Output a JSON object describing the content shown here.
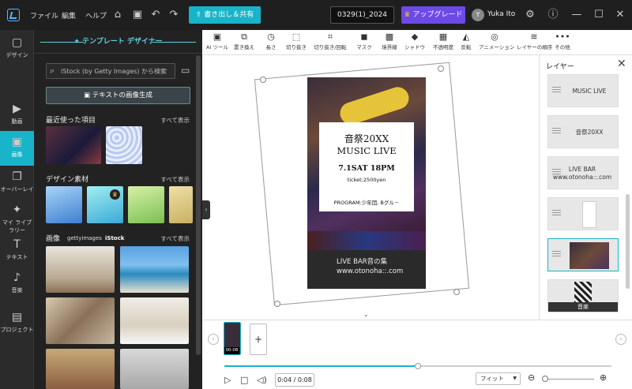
{
  "menu": [
    "ファイル",
    "編集",
    "ヘルプ"
  ],
  "toolbar_top": {
    "export_label": "書き出し＆共有",
    "filename": "0329(1)_2024",
    "upgrade_label": "アップグレード",
    "avatar_letter": "Y",
    "user_name": "Yuka Ito"
  },
  "rail": [
    {
      "icon": "▢",
      "label": "デザイン"
    },
    {
      "icon": "▶",
      "label": "動画"
    },
    {
      "icon": "▣",
      "label": "画像"
    },
    {
      "icon": "❐",
      "label": "オーバーレイ"
    },
    {
      "icon": "✦",
      "label": "マイ ライブラリー"
    },
    {
      "icon": "T",
      "label": "テキスト"
    },
    {
      "icon": "♪",
      "label": "音楽"
    },
    {
      "icon": "▤",
      "label": "プロジェクト"
    }
  ],
  "panel": {
    "title": "テンプレート デザイナー",
    "search_placeholder": "iStock (by Getty Images) から検索",
    "generate_label": "テキストの画像生成",
    "recent_heading": "最近使った項目",
    "design_heading": "デザイン素材",
    "images_heading": "画像",
    "see_all": "すべて表示",
    "getty": "gettyimages",
    "istock": "iStock"
  },
  "tools": [
    {
      "icon": "▣",
      "label": "AI ツール"
    },
    {
      "icon": "⧉",
      "label": "置き換え"
    },
    {
      "icon": "◷",
      "label": "長さ"
    },
    {
      "icon": "⬚",
      "label": "切り抜き"
    },
    {
      "icon": "⌗",
      "label": "切り抜き/回転"
    },
    {
      "icon": "◼",
      "label": "マスク"
    },
    {
      "icon": "▩",
      "label": "境界線"
    },
    {
      "icon": "◆",
      "label": "シャドウ"
    },
    {
      "icon": "▦",
      "label": "不透明度"
    },
    {
      "icon": "◭",
      "label": "反転"
    },
    {
      "icon": "◎",
      "label": "アニメーション"
    },
    {
      "icon": "≋",
      "label": "レイヤーの順序"
    },
    {
      "icon": "•••",
      "label": "その他"
    }
  ],
  "poster": {
    "line1": "音祭20XX",
    "line2": "MUSIC LIVE",
    "date": "7.1SAT 18PM",
    "ticket": "ticket:2500yen",
    "program": "PROGRAM:少年団, Bグル－",
    "foot1": "LIVE BAR音の集",
    "foot2": "www.otonoha::.com"
  },
  "layers": {
    "title": "レイヤー",
    "items": [
      "MUSIC LIVE",
      "音祭20XX",
      "LIVE BAR www.otonoha::.com",
      "",
      "",
      ""
    ],
    "audio_label": "音楽"
  },
  "timeline": {
    "clip_time": "00:08",
    "add_label": "+",
    "time": "0:04 / 0:08",
    "progress": 0.5,
    "zoom_label": "フィット"
  },
  "colors": {
    "accent": "#18b4c9",
    "upgrade": "#6d4ae8"
  }
}
